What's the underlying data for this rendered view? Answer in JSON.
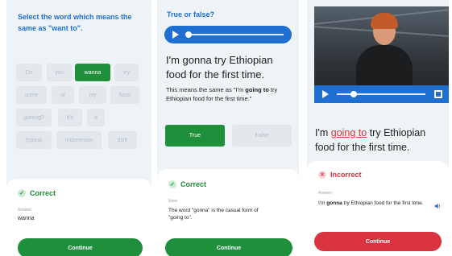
{
  "panel1": {
    "question": "Select the word which means the same as \"want to\".",
    "chips": [
      "Do",
      "you",
      "wanna",
      "try",
      "some",
      "of",
      "my",
      "Nasi",
      "goreng?",
      "It's",
      "a",
      "typical",
      "Indonesian",
      "dish"
    ],
    "selected_chip": "wanna",
    "feedback": {
      "status": "Correct",
      "check_glyph": "✓",
      "answer_label": "Answer:",
      "answer": "wanna",
      "continue_label": "Continue"
    }
  },
  "panel2": {
    "title": "True or false?",
    "sentence": "I'm gonna try Ethiopian food for the first time.",
    "explanation_pre": "This means the same as \"I'm ",
    "explanation_bold": "going to",
    "explanation_post": " try Ethiopian food for the first time.\"",
    "true_label": "True",
    "false_label": "False",
    "feedback": {
      "status": "Correct",
      "check_glyph": "✓",
      "note_label": "Note:",
      "note": "The word \"gonna\" is the casual form of \"going to\".",
      "continue_label": "Continue"
    }
  },
  "panel3": {
    "sentence_pre": "I'm ",
    "sentence_highlight": "going to",
    "sentence_post": " try Ethiopian food for the first time.",
    "feedback": {
      "status": "Incorrect",
      "x_glyph": "✕",
      "answer_label": "Answer:",
      "answer_pre": "I'm ",
      "answer_bold": "gonna",
      "answer_post": " try Ethiopian food for the first time.",
      "continue_label": "Continue"
    }
  },
  "colors": {
    "accent_blue": "#1f6fd1",
    "success_green": "#1e8f3b",
    "error_red": "#d8333e",
    "panel_bg": "#eef3f8"
  },
  "icons": [
    "play-icon",
    "check-icon",
    "x-icon",
    "fullscreen-icon",
    "speaker-icon"
  ]
}
